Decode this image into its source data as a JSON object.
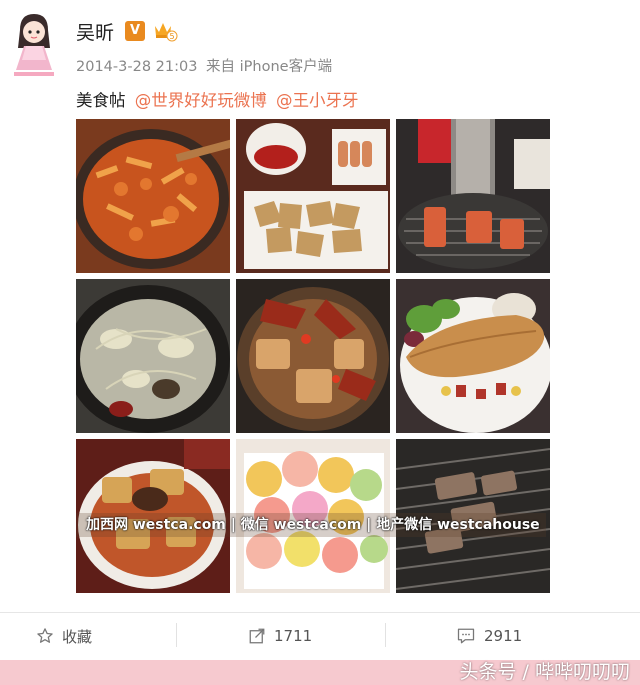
{
  "post": {
    "username": "吴昕",
    "verified_badge": "V",
    "level_badge": "5",
    "timestamp": "2014-3-28 21:03",
    "source": "来自 iPhone客户端",
    "text": "美食帖",
    "mentions": [
      "@世界好好玩微博",
      "@王小牙牙"
    ]
  },
  "photos": [
    {
      "name": "photo-stir-fry"
    },
    {
      "name": "photo-fries-platter"
    },
    {
      "name": "photo-korean-bbq"
    },
    {
      "name": "photo-soup-pot"
    },
    {
      "name": "photo-seafood-stew"
    },
    {
      "name": "photo-omelette-plate"
    },
    {
      "name": "photo-baked-casserole"
    },
    {
      "name": "photo-colorful-candies"
    },
    {
      "name": "photo-grilled-meat"
    }
  ],
  "watermark": "加西网 westca.com | 微信 westcacom | 地产微信 westcahouse",
  "actions": {
    "favorite_label": "收藏",
    "repost_count": "1711",
    "comment_count": "2911"
  },
  "footer": {
    "credit": "头条号 / 哔哔叨叨叨"
  },
  "icons": [
    "star-icon",
    "repost-icon",
    "comment-icon"
  ],
  "colors": {
    "mention": "#eb7350",
    "verified_badge": "#e98a1f",
    "footer_bar": "#f6c9cf"
  }
}
